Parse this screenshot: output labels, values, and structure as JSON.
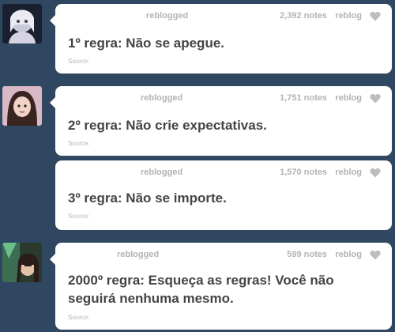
{
  "posts": [
    {
      "reblogged_label": "reblogged",
      "notes": "2,392 notes",
      "reblog_label": "reblog",
      "text": "1º regra: Não se apegue.",
      "source_label": "Source:"
    },
    {
      "reblogged_label": "reblogged",
      "notes": "1,751 notes",
      "reblog_label": "reblog",
      "text": "2º regra: Não crie expectativas.",
      "source_label": "Source:"
    },
    {
      "reblogged_label": "reblogged",
      "notes": "1,570 notes",
      "reblog_label": "reblog",
      "text": "3º regra: Não se importe.",
      "source_label": "Source:"
    },
    {
      "reblogged_label": "reblogged",
      "notes": "599 notes",
      "reblog_label": "reblog",
      "text": "2000º regra: Esqueça as regras! Você não seguirá nenhuma mesmo.",
      "source_label": "Source:"
    }
  ],
  "icons": {
    "like": "heart-icon"
  },
  "colors": {
    "dashboard_background": "#2f4760",
    "post_background": "#ffffff",
    "text": "#444444",
    "meta": "#b3b3b3"
  }
}
